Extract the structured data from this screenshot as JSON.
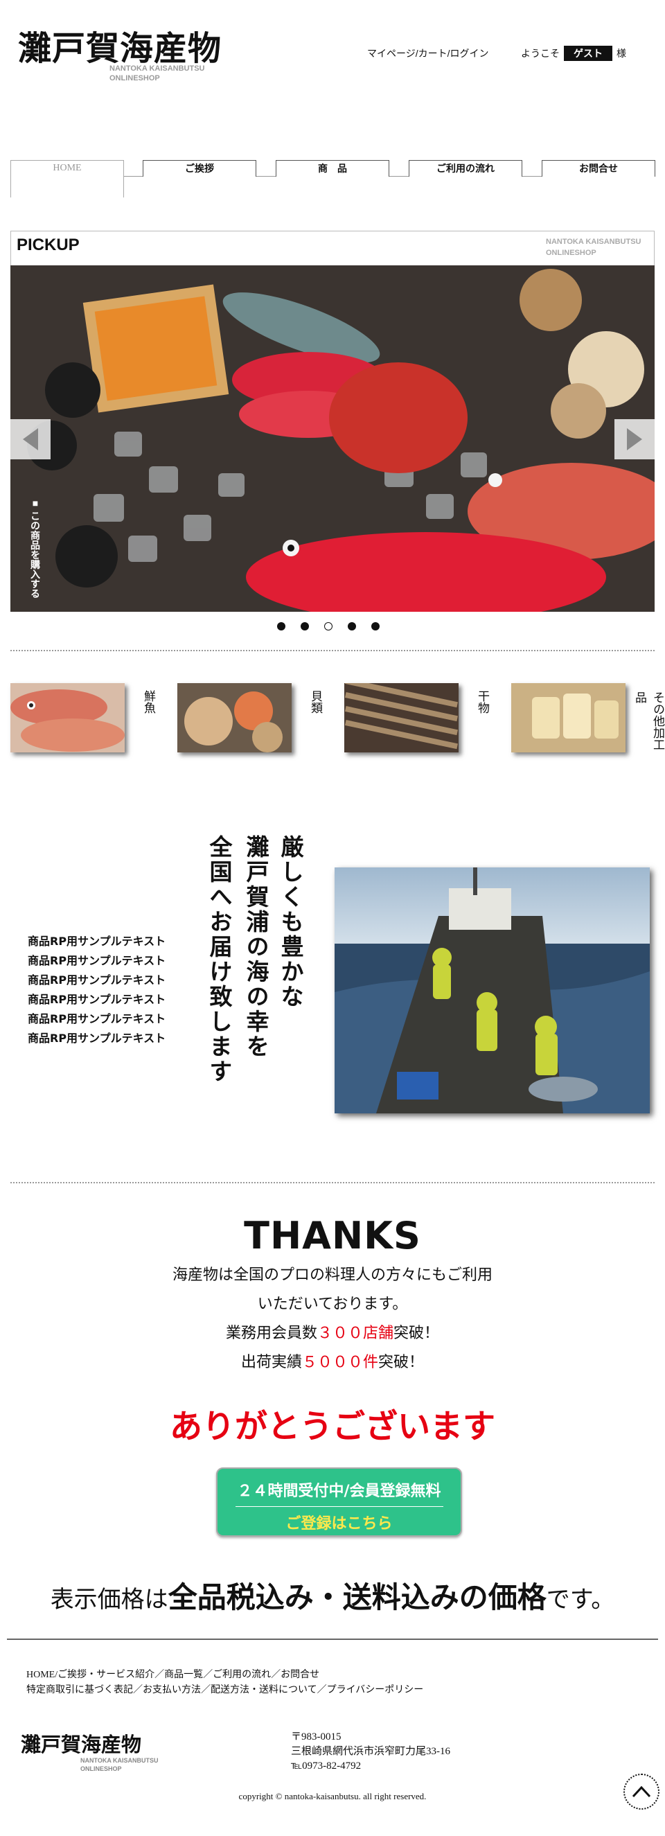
{
  "header": {
    "logo_ja": "灘戸賀海産物",
    "logo_en_line1": "NANTOKA KAISANBUTSU",
    "logo_en_line2": "ONLINESHOP",
    "links": "マイページ/カート/ログイン",
    "welcome_prefix": "ようこそ",
    "guest": "ゲスト",
    "welcome_suffix": "様"
  },
  "nav": {
    "tabs": [
      "HOME",
      "ご挨拶",
      "商　品",
      "ご利用の流れ",
      "お問合せ"
    ]
  },
  "pickup": {
    "title": "PICKUP",
    "en_line1": "NANTOKA KAISANBUTSU",
    "en_line2": "ONLINESHOP",
    "buy_label": "■ この商品を購入する",
    "slide_count": 5,
    "active_slide": 3
  },
  "categories": [
    {
      "label": "鮮魚",
      "icon": "fresh-fish"
    },
    {
      "label": "貝類",
      "icon": "shellfish"
    },
    {
      "label": "干物",
      "icon": "dried-fish"
    },
    {
      "label": "その他加工品",
      "icon": "processed"
    }
  ],
  "feature": {
    "title_col1": "厳しくも豊かな",
    "title_col2": "灘戸賀浦の海の幸を",
    "title_col3": "全国へお届け致します",
    "samples": [
      "商品RP用サンプルテキスト",
      "商品RP用サンプルテキスト",
      "商品RP用サンプルテキスト",
      "商品RP用サンプルテキスト",
      "商品RP用サンプルテキスト",
      "商品RP用サンプルテキスト"
    ]
  },
  "thanks": {
    "title": "THANKS",
    "line1": "海産物は全国のプロの料理人の方々にもご利用",
    "line2": "いただいております。",
    "line3_pre": "業務用会員数",
    "line3_red": "３００店舗",
    "line3_post": "突破！",
    "line4_pre": "出荷実績",
    "line4_red": "５０００件",
    "line4_post": "突破！",
    "arigato": "ありがとうございます"
  },
  "cta": {
    "line1": "２４時間受付中/会員登録無料",
    "line2": "ご登録はこちら"
  },
  "price_note": {
    "pre": "表示価格は",
    "bold": "全品税込み・送料込みの価格",
    "post": "です。"
  },
  "footer": {
    "links_line1": "HOME/ご挨拶・サービス紹介／商品一覧／ご利用の流れ／お問合せ",
    "links_line2": "特定商取引に基づく表記／お支払い方法／配送方法・送料について／プライバシーポリシー",
    "logo_ja": "灘戸賀海産物",
    "logo_en_line1": "NANTOKA KAISANBUTSU",
    "logo_en_line2": "ONLINESHOP",
    "postal": "〒983-0015",
    "address": "三根崎県網代浜市浜窄町力尾33-16",
    "tel": "℡0973-82-4792",
    "copyright": "copyright © nantoka-kaisanbutsu. all right reserved."
  },
  "colors": {
    "accent_red": "#e60012",
    "cta_green": "#2ec28a",
    "cta_yellow": "#ffe84c"
  }
}
